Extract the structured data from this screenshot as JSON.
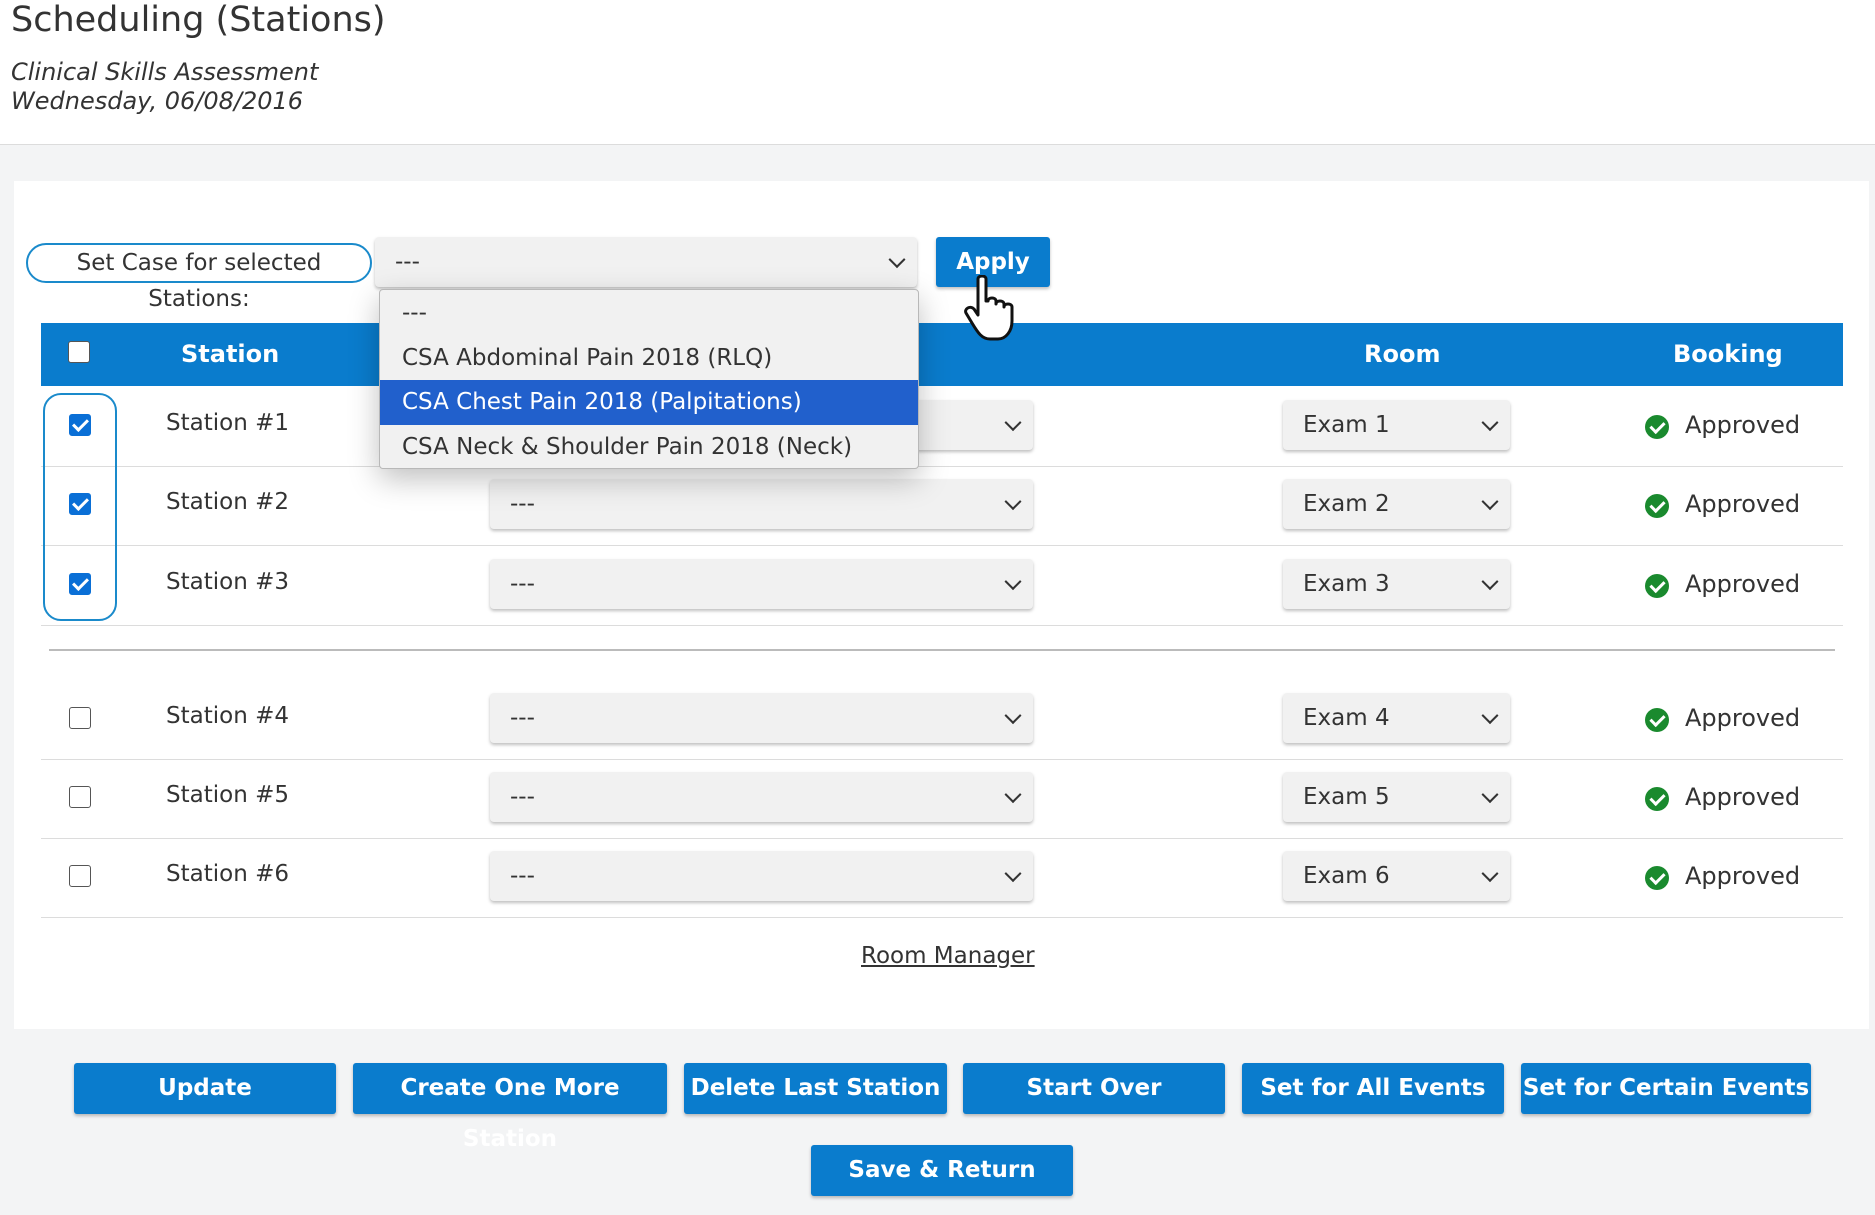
{
  "page": {
    "title": "Scheduling (Stations)",
    "subtitle_line1": "Clinical Skills Assessment",
    "subtitle_line2": "Wednesday, 06/08/2016"
  },
  "toolbar": {
    "set_case_label": "Set Case for selected Stations:",
    "set_case_value": "---",
    "apply_label": "Apply",
    "dropdown_options": [
      "---",
      "CSA Abdominal Pain 2018 (RLQ)",
      "CSA Chest Pain 2018 (Palpitations)",
      "CSA Neck & Shoulder Pain 2018 (Neck)"
    ],
    "highlighted_option": "CSA Chest Pain 2018 (Palpitations)"
  },
  "table": {
    "headers": {
      "station": "Station",
      "room": "Room",
      "booking": "Booking"
    },
    "header_checked": false,
    "rows": [
      {
        "checked": true,
        "station": "Station #1",
        "case": "---",
        "room": "Exam 1",
        "booking": "Approved"
      },
      {
        "checked": true,
        "station": "Station #2",
        "case": "---",
        "room": "Exam 2",
        "booking": "Approved"
      },
      {
        "checked": true,
        "station": "Station #3",
        "case": "---",
        "room": "Exam 3",
        "booking": "Approved"
      },
      {
        "checked": false,
        "station": "Station #4",
        "case": "---",
        "room": "Exam 4",
        "booking": "Approved"
      },
      {
        "checked": false,
        "station": "Station #5",
        "case": "---",
        "room": "Exam 5",
        "booking": "Approved"
      },
      {
        "checked": false,
        "station": "Station #6",
        "case": "---",
        "room": "Exam 6",
        "booking": "Approved"
      }
    ]
  },
  "room_manager_link": "Room Manager",
  "actions": {
    "update": "Update",
    "create": "Create One More Station",
    "delete": "Delete Last Station",
    "start_over": "Start Over",
    "set_all": "Set for All Events",
    "set_certain": "Set for Certain Events",
    "save_return": "Save & Return"
  },
  "colors": {
    "primary": "#0a7ccd",
    "highlight": "#2160cc",
    "approved_icon": "#1a8a2e",
    "selection_outline": "#1a8acb"
  }
}
